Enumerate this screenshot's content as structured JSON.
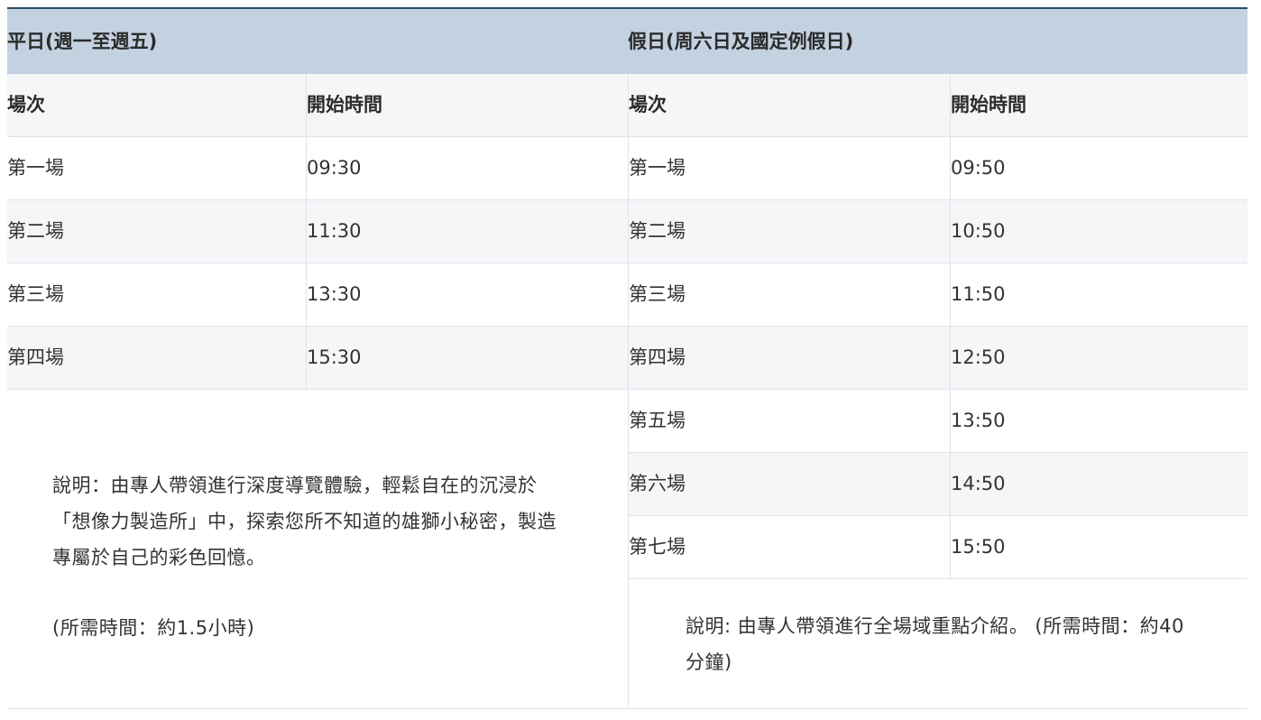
{
  "weekday": {
    "title": "平日(週一至週五)",
    "col_session": "場次",
    "col_start": "開始時間",
    "rows": [
      {
        "session": "第一場",
        "time": "09:30"
      },
      {
        "session": "第二場",
        "time": "11:30"
      },
      {
        "session": "第三場",
        "time": "13:30"
      },
      {
        "session": "第四場",
        "time": "15:30"
      }
    ],
    "note_lines": [
      "說明：由專人帶領進行深度導覽體驗，輕鬆自在的沉浸於",
      "「想像力製造所」中，探索您所不知道的雄獅小秘密，製造",
      "專屬於自己的彩色回憶。"
    ],
    "duration": "(所需時間：約1.5小時)"
  },
  "holiday": {
    "title": "假日(周六日及國定例假日)",
    "col_session": "場次",
    "col_start": "開始時間",
    "rows": [
      {
        "session": "第一場",
        "time": "09:50"
      },
      {
        "session": "第二場",
        "time": "10:50"
      },
      {
        "session": "第三場",
        "time": "11:50"
      },
      {
        "session": "第四場",
        "time": "12:50"
      },
      {
        "session": "第五場",
        "time": "13:50"
      },
      {
        "session": "第六場",
        "time": "14:50"
      },
      {
        "session": "第七場",
        "time": "15:50"
      }
    ],
    "note_lines": [
      "說明: 由專人帶領進行全場域重點介紹。 (所需時間：約40",
      "分鐘)"
    ]
  }
}
